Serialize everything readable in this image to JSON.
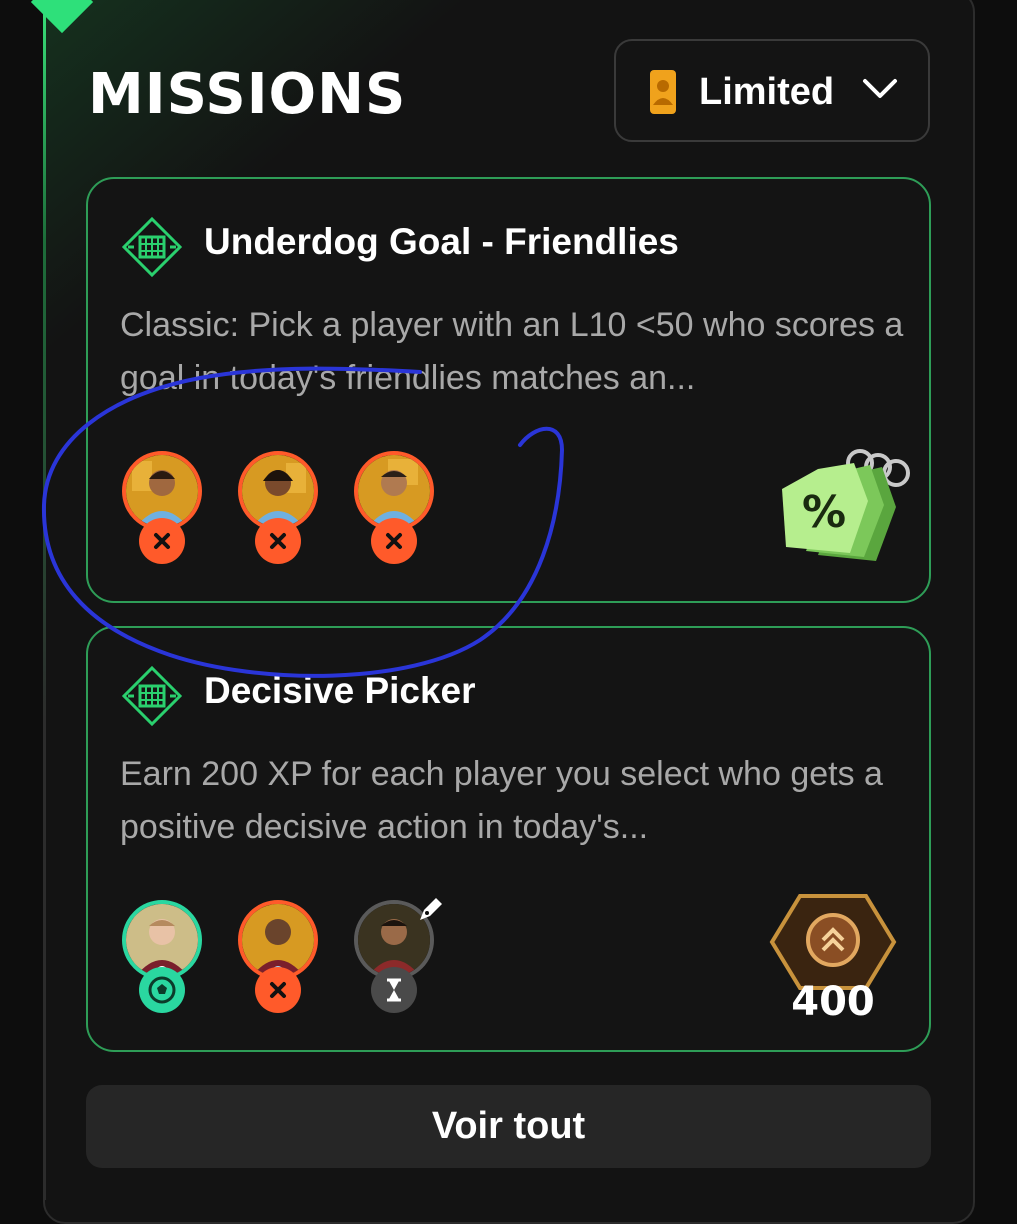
{
  "header": {
    "title": "MISSIONS"
  },
  "filter": {
    "selected": "Limited"
  },
  "missions": [
    {
      "title": "Underdog Goal - Friendlies",
      "description": "Classic: Pick a player with an L10 <50 who scores a goal in today's friendlies matches an...",
      "players": [
        {
          "status": "failed"
        },
        {
          "status": "failed"
        },
        {
          "status": "failed"
        }
      ],
      "reward_icon": "percent-tag-icon"
    },
    {
      "title": "Decisive Picker",
      "description": "Earn 200 XP for each player you select who gets a positive decisive action in today's...",
      "players": [
        {
          "status": "goal"
        },
        {
          "status": "failed"
        },
        {
          "status": "pending"
        }
      ],
      "reward_icon": "xp-hexagon-icon",
      "reward_value": "400"
    }
  ],
  "footer": {
    "see_all_label": "Voir tout"
  },
  "colors": {
    "accent_green": "#2ee07a",
    "card_border": "#2e9d57",
    "failed": "#ff5a2a",
    "success": "#2ad7a0",
    "annotation_ink": "#2a35d8"
  }
}
